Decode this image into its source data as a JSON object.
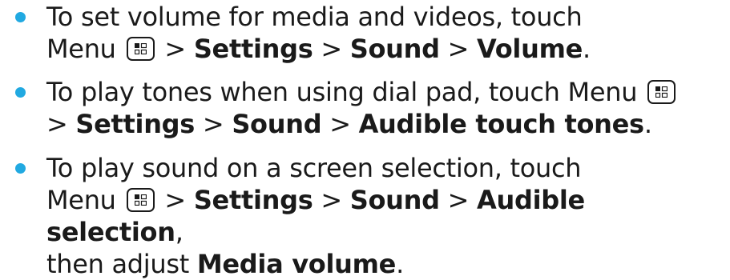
{
  "items": [
    {
      "line1": "To set volume for media and videos, touch",
      "menu": "Menu",
      "sep1": ">",
      "settings": "Settings",
      "sep2": ">",
      "sound": "Sound",
      "sep3": ">",
      "target": "Volume",
      "end": "."
    },
    {
      "line1": "To play tones when using dial pad, touch Menu",
      "sep1": ">",
      "settings": "Settings",
      "sep2": ">",
      "sound": "Sound",
      "sep3": ">",
      "target": "Audible touch tones",
      "end": "."
    },
    {
      "line1": "To play sound on a screen selection, touch",
      "menu": "Menu",
      "sep1": ">",
      "settings": "Settings",
      "sep2": ">",
      "sound": "Sound",
      "sep3": ">",
      "target": "Audible selection",
      "comma": ",",
      "then": "then adjust",
      "media": "Media volume",
      "end": "."
    }
  ],
  "colors": {
    "bullet": "#21a9e1",
    "text": "#1a1a1a"
  },
  "icons": {
    "menu_key": "menu-key-icon"
  }
}
